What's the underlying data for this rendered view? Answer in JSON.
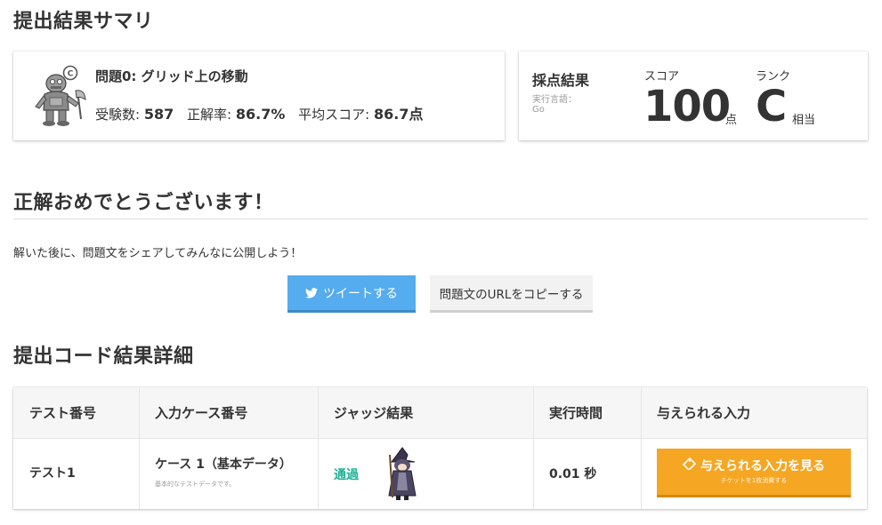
{
  "page": {
    "summary_title": "提出結果サマリ",
    "congrats_title": "正解おめでとうございます！",
    "share_text": "解いた後に、問題文をシェアしてみんなに公開しよう！",
    "details_title": "提出コード結果詳細"
  },
  "problem": {
    "title": "問題0: グリッド上の移動",
    "examinees_label": "受験数:",
    "examinees": "587",
    "accuracy_label": "正解率:",
    "accuracy": "86.7%",
    "avg_label": "平均スコア:",
    "avg_score": "86.7点",
    "avatar_badge": "C"
  },
  "score": {
    "heading": "採点結果",
    "lang_label": "実行言語：",
    "lang_value": "Go",
    "score_label": "スコア",
    "score_value": "100",
    "score_unit": "点",
    "rank_label": "ランク",
    "rank_value": "C",
    "rank_unit": "相当"
  },
  "buttons": {
    "tweet": "ツイートする",
    "copy_url": "問題文のURLをコピーする",
    "view_input": "与えられる入力を見る",
    "view_input_sub": "チケットを1枚消費する"
  },
  "table": {
    "headers": [
      "テスト番号",
      "入力ケース番号",
      "ジャッジ結果",
      "実行時間",
      "与えられる入力"
    ],
    "rows": [
      {
        "test": "テスト1",
        "case": "ケース 1（基本データ）",
        "case_desc": "基本的なテストデータです。",
        "judge": "通過",
        "time": "0.01 秒"
      }
    ]
  },
  "colors": {
    "tweet": "#55acee",
    "view_input": "#f5a623",
    "judge_pass": "#1ab394"
  },
  "icons": [
    "twitter-bird-icon",
    "ticket-icon",
    "robot-avatar",
    "witch-character"
  ]
}
